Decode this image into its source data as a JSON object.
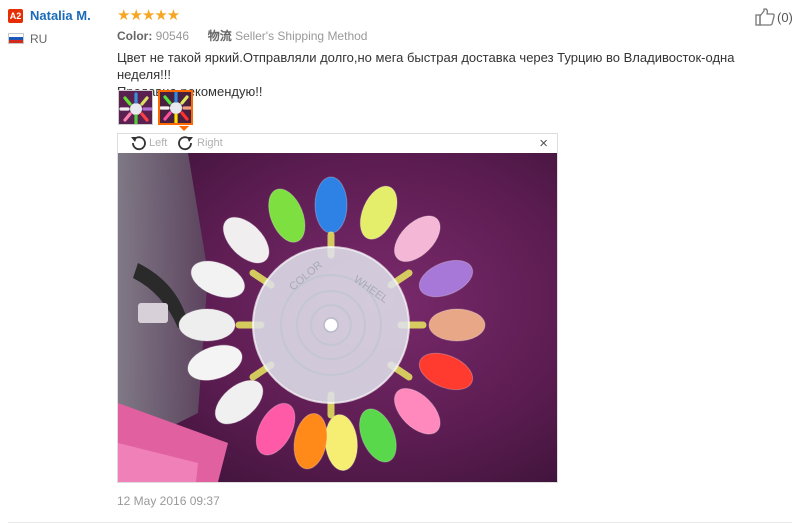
{
  "reviewer": {
    "level_badge": "A2",
    "name": "Natalia M.",
    "country": "RU"
  },
  "rating": {
    "stars_filled": 5,
    "stars_total": 5,
    "stars_text": "★★★★★"
  },
  "attributes": [
    {
      "key": "Color:",
      "value": "90546"
    },
    {
      "key": "物流",
      "value": "Seller's Shipping Method"
    }
  ],
  "helpful": {
    "count_text": "(0)"
  },
  "review_text_lines": [
    "Цвет не такой яркий.Отправляли долго,но мега быстрая доставка через Турцию во Владивосток-одна неделя!!!",
    "Продавца рекомендую!!"
  ],
  "images": {
    "count": 2,
    "active_index": 1
  },
  "viewer": {
    "rotate_left_label": "Left",
    "rotate_right_label": "Right",
    "close_glyph": "×",
    "wheel_text_left": "COLOR",
    "wheel_text_right": "WHEEL"
  },
  "date": "12 May 2016 09:37",
  "colors": {
    "name_link": "#1a6bb8",
    "badge": "#e62e04",
    "stars": "#f6a623",
    "active_thumb": "#ff6a00",
    "photo_background": "#5a2050"
  }
}
